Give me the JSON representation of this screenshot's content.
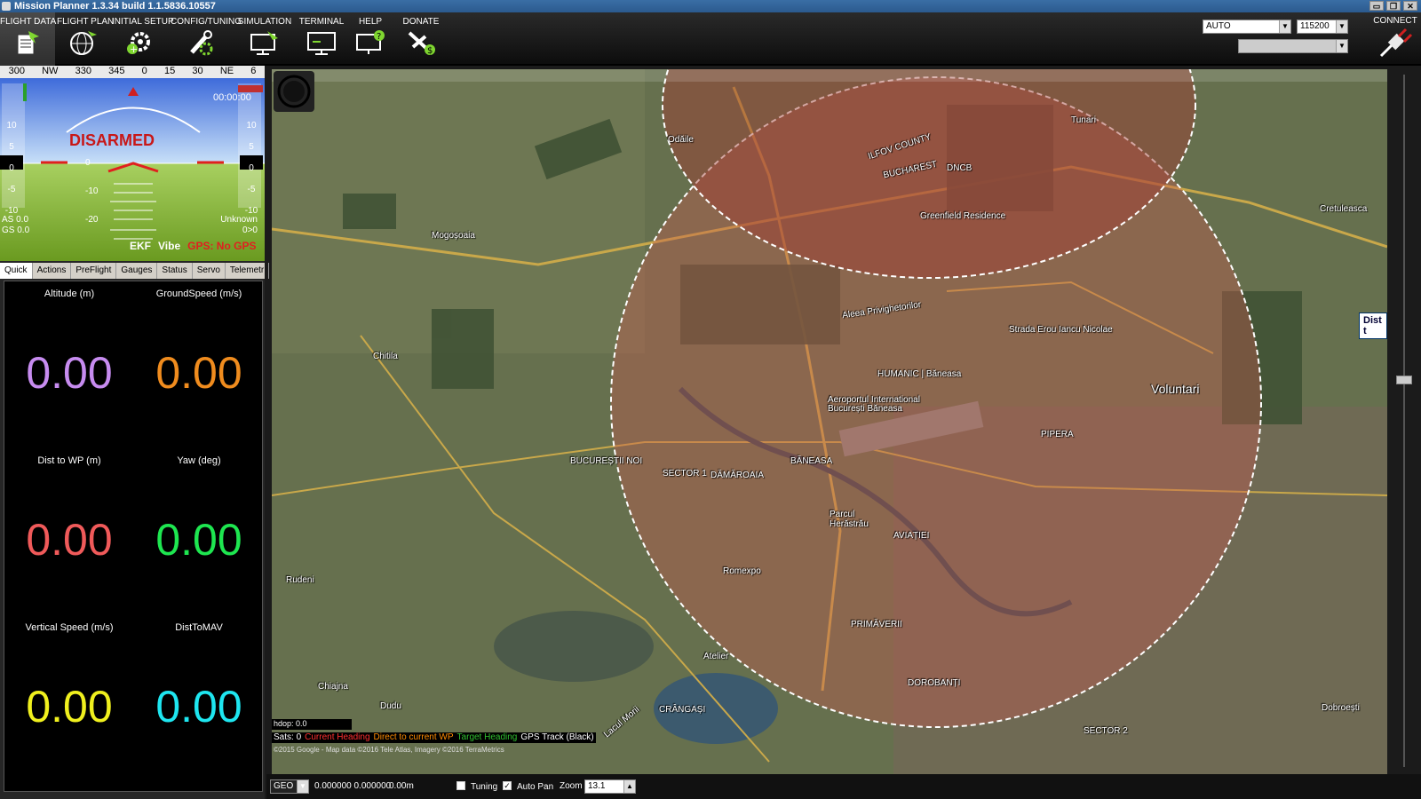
{
  "window": {
    "title": "Mission Planner 1.3.34 build 1.1.5836.10557",
    "btn_min": "▭",
    "btn_max": "❐",
    "btn_close": "✕"
  },
  "toolbar": {
    "items": [
      {
        "label": "FLIGHT DATA",
        "icon": "flight-data-icon"
      },
      {
        "label": "FLIGHT PLAN",
        "icon": "globe-icon"
      },
      {
        "label": "INITIAL SETUP",
        "icon": "gear-plus-icon"
      },
      {
        "label": "CONFIG/TUNING",
        "icon": "wrench-gear-icon"
      },
      {
        "label": "SIMULATION",
        "icon": "monitor-plane-icon"
      },
      {
        "label": "TERMINAL",
        "icon": "terminal-icon"
      },
      {
        "label": "HELP",
        "icon": "help-monitor-icon"
      },
      {
        "label": "DONATE",
        "icon": "donate-plane-icon"
      }
    ],
    "mode_select": "AUTO",
    "baud_select": "115200",
    "connect_label": "CONNECT"
  },
  "hud": {
    "heading_labels": [
      "300",
      "NW",
      "330",
      "345",
      "0",
      "15",
      "30",
      "NE",
      "6"
    ],
    "status": "DISARMED",
    "airspeed": "AS 0.0",
    "groundspeed": "GS 0.0",
    "gps_status": "GPS: No GPS",
    "ekf": "EKF",
    "vibe": "Vibe",
    "unknown": "Unknown",
    "unknown_value": "0>0",
    "time": "00:00:00",
    "pitch_labels": [
      "0",
      "-10",
      "-20"
    ],
    "left_scale": [
      "10",
      "5",
      "0",
      "-5",
      "-10"
    ],
    "right_scale": [
      "10",
      "5",
      "0",
      "-5",
      "-10"
    ]
  },
  "tabs": [
    "Quick",
    "Actions",
    "PreFlight",
    "Gauges",
    "Status",
    "Servo",
    "Telemetr"
  ],
  "quick": [
    {
      "label": "Altitude (m)",
      "value": "0.00",
      "color": "#c78cf0"
    },
    {
      "label": "GroundSpeed (m/s)",
      "value": "0.00",
      "color": "#f08c1e"
    },
    {
      "label": "Dist to WP (m)",
      "value": "0.00",
      "color": "#f05a5a"
    },
    {
      "label": "Yaw (deg)",
      "value": "0.00",
      "color": "#1ee650"
    },
    {
      "label": "Vertical Speed (m/s)",
      "value": "0.00",
      "color": "#f0f01e"
    },
    {
      "label": "DistToMAV",
      "value": "0.00",
      "color": "#1ee6f0"
    }
  ],
  "map": {
    "labels": [
      "Odăile",
      "Tunari",
      "ILFOV COUNTY",
      "BUCHAREST",
      "DNCB",
      "Greenfield Residence",
      "Mogoșoaia",
      "Chitila",
      "Aleea Privighetorilor",
      "Strada Erou Iancu Nicolae",
      "HUMANIC | Băneasa",
      "Aeroportul International București Băneasa",
      "Voluntari",
      "PIPERA",
      "BĂNEASA",
      "SECTOR 1",
      "DĂMĂROAIA",
      "BUCUREȘTII NOI",
      "Parcul Herăstrău",
      "AVIAȚIEI",
      "Romexpo",
      "PRIMĂVERII",
      "Atelier",
      "DOROBANȚI",
      "Rudeni",
      "Chiajna",
      "Dudu",
      "CRÂNGAȘI",
      "Lacul Morii",
      "Cretuleasca",
      "Dobroești",
      "SECTOR 2"
    ],
    "dist_tag": "Dist t",
    "hdop": "hdop: 0.0",
    "sats": "Sats: 0",
    "legend": [
      {
        "text": "Current Heading",
        "color": "#ff3030"
      },
      {
        "text": "Direct to current WP",
        "color": "#ff8c00"
      },
      {
        "text": "Target Heading",
        "color": "#30c030"
      },
      {
        "text": "GPS Track (Black)",
        "color": "#ffffff"
      }
    ],
    "copyright": "©2015 Google - Map data ©2016 Tele Atlas, Imagery ©2016 TerraMetrics"
  },
  "status": {
    "coord_system": "GEO",
    "coords": "0.000000 0.000000",
    "alt": "0.00m",
    "tuning_label": "Tuning",
    "autopan_label": "Auto Pan",
    "zoom_label": "Zoom",
    "zoom_value": "13.1"
  }
}
